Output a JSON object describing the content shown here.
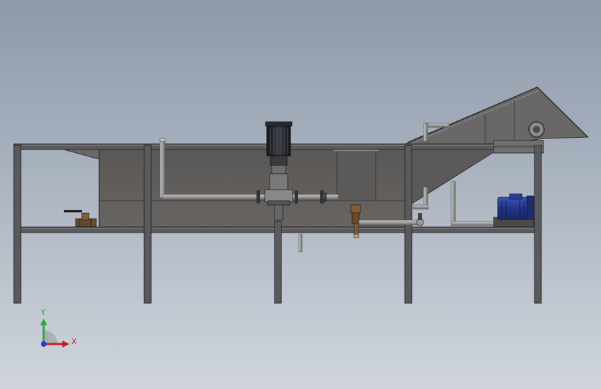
{
  "triad": {
    "x_label": "X",
    "y_label": "Y",
    "x_color": "#c0202a",
    "y_color": "#2fa83a",
    "z_color": "#2a3ccf"
  },
  "colors": {
    "background_top": "#8e99a8",
    "background_bottom": "#d0d5dc",
    "frame": "#58585a",
    "tank": "#5f5d5b",
    "pipe": "#9a9a9a",
    "motor_body": "#1f2028",
    "pump_motor": "#2a3d8f"
  }
}
